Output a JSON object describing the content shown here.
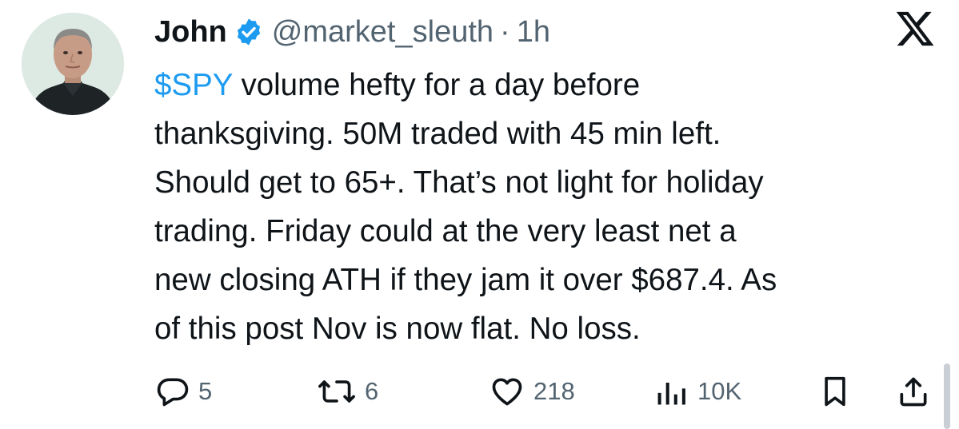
{
  "user": {
    "name": "John",
    "handle": "@market_sleuth",
    "separator": "·",
    "time": "1h",
    "verified": true
  },
  "brand": {
    "logo_icon": "x-logo-icon"
  },
  "tweet": {
    "cashtag": "$SPY",
    "lines": [
      " volume hefty for a day before",
      "thanksgiving. 50M traded with 45 min left.",
      "Should get to 65+. That’s not light for holiday",
      "trading. Friday could at the very least net a",
      "new closing ATH if they jam it over $687.4. As",
      "of this post Nov is now flat. No loss."
    ]
  },
  "actions": {
    "replies": "5",
    "retweets": "6",
    "likes": "218",
    "views": "10K"
  },
  "colors": {
    "text": "#0f1419",
    "muted": "#536471",
    "accent": "#1d9bf0",
    "background": "#ffffff"
  }
}
